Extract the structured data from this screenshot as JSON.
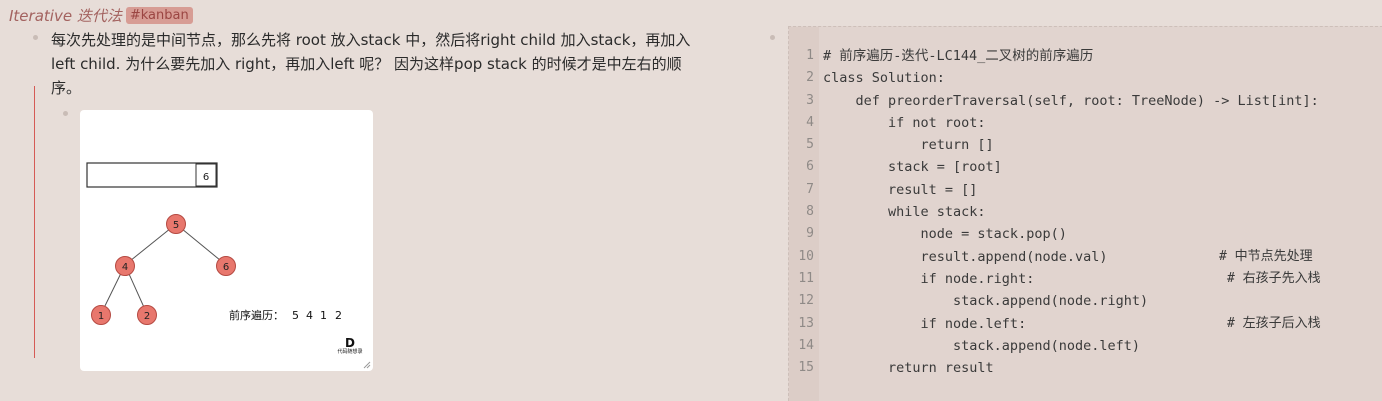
{
  "heading": {
    "title": "Iterative 迭代法",
    "tag": "#kanban"
  },
  "paragraph": {
    "line1": "每次先处理的是中间节点，那么先将 root 放入stack 中，然后将right child 加入stack，再加入",
    "line2": "left child. 为什么要先加入 right，再加入left 呢？ 因为这样pop stack 的时候才是中左右的顺",
    "line3": "序。"
  },
  "image": {
    "box_value": "6",
    "tree_nodes": [
      "5",
      "4",
      "6",
      "1",
      "2"
    ],
    "caption": "前序遍历：",
    "sequence": [
      "5",
      "4",
      "1",
      "2"
    ],
    "logo_mark": "D",
    "logo_text": "代码随想录",
    "node_color": "#e8776d"
  },
  "code": {
    "lines": [
      {
        "n": "1",
        "text": "# 前序遍历-迭代-LC144_二叉树的前序遍历",
        "comment": ""
      },
      {
        "n": "2",
        "text": "class Solution:",
        "comment": ""
      },
      {
        "n": "3",
        "text": "    def preorderTraversal(self, root: TreeNode) -> List[int]:",
        "comment": ""
      },
      {
        "n": "4",
        "text": "        if not root:",
        "comment": ""
      },
      {
        "n": "5",
        "text": "            return []",
        "comment": ""
      },
      {
        "n": "6",
        "text": "        stack = [root]",
        "comment": ""
      },
      {
        "n": "7",
        "text": "        result = []",
        "comment": ""
      },
      {
        "n": "8",
        "text": "        while stack:",
        "comment": ""
      },
      {
        "n": "9",
        "text": "            node = stack.pop()",
        "comment": ""
      },
      {
        "n": "10",
        "text": "            result.append(node.val)",
        "comment": "# 中节点先处理"
      },
      {
        "n": "11",
        "text": "            if node.right:",
        "comment": "# 右孩子先入栈"
      },
      {
        "n": "12",
        "text": "                stack.append(node.right)",
        "comment": ""
      },
      {
        "n": "13",
        "text": "            if node.left:",
        "comment": "# 左孩子后入栈"
      },
      {
        "n": "14",
        "text": "                stack.append(node.left)",
        "comment": ""
      },
      {
        "n": "15",
        "text": "        return result",
        "comment": ""
      }
    ]
  }
}
